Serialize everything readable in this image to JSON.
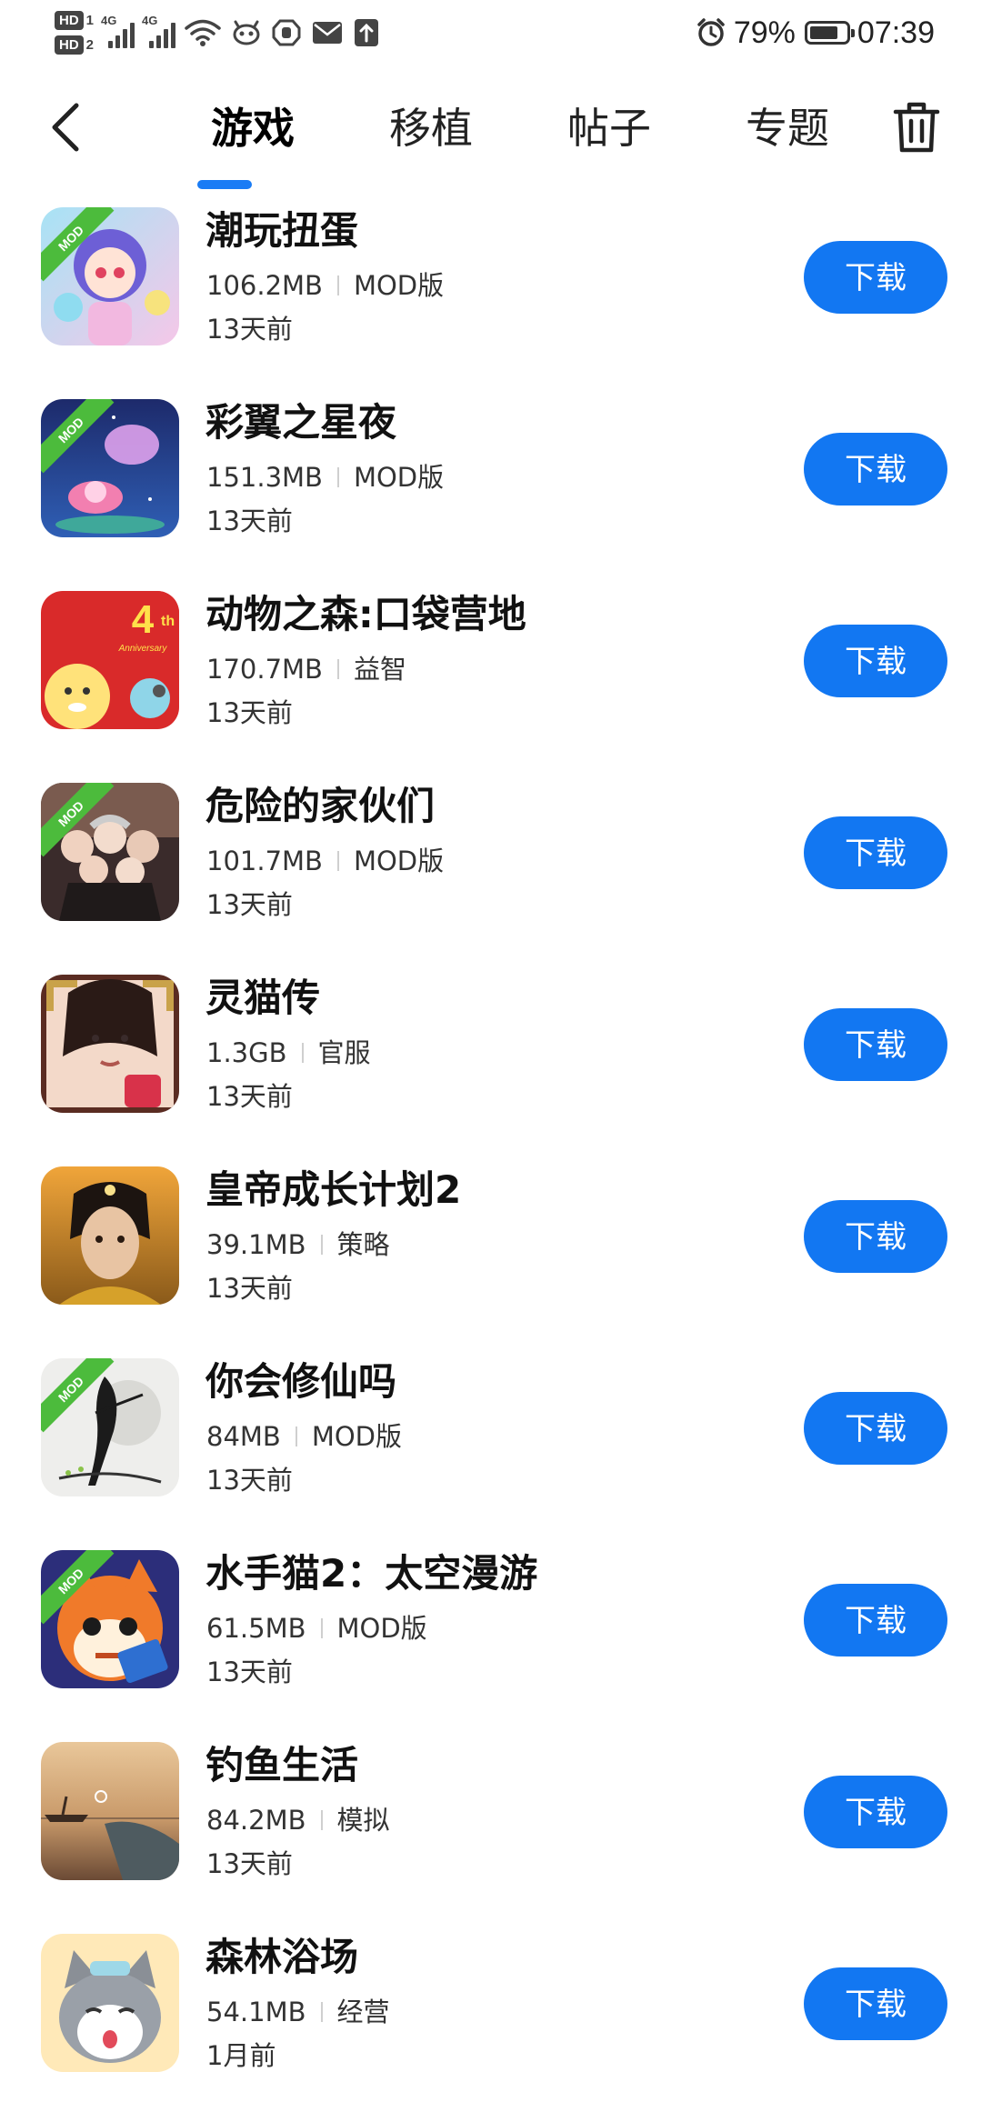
{
  "status_bar": {
    "hd1": "HD",
    "hd1_num": "1",
    "hd2": "HD",
    "hd2_num": "2",
    "network1": "4G",
    "network2": "4G",
    "battery_percent": "79%",
    "battery_level": 0.79,
    "time": "07:39",
    "icons": [
      "signal-icon",
      "signal-icon",
      "wifi-icon",
      "app-notification-icon",
      "hand-icon",
      "mail-icon",
      "upload-icon",
      "alarm-icon",
      "battery-icon"
    ]
  },
  "nav": {
    "back_icon": "chevron-left-icon",
    "tabs": [
      {
        "label": "游戏",
        "active": true
      },
      {
        "label": "移植",
        "active": false
      },
      {
        "label": "帖子",
        "active": false
      },
      {
        "label": "专题",
        "active": false
      }
    ],
    "trash_icon": "trash-icon"
  },
  "accent_color": "#1277f2",
  "mod_ribbon_color": "#4cbb3c",
  "games": [
    {
      "title": "潮玩扭蛋",
      "size": "106.2MB",
      "tag": "MOD版",
      "time": "13天前",
      "button": "下载",
      "mod": true,
      "mod_label": "MOD"
    },
    {
      "title": "彩翼之星夜",
      "size": "151.3MB",
      "tag": "MOD版",
      "time": "13天前",
      "button": "下载",
      "mod": true,
      "mod_label": "MOD"
    },
    {
      "title": "动物之森:口袋营地",
      "size": "170.7MB",
      "tag": "益智",
      "time": "13天前",
      "button": "下载",
      "mod": false,
      "mod_label": ""
    },
    {
      "title": "危险的家伙们",
      "size": "101.7MB",
      "tag": "MOD版",
      "time": "13天前",
      "button": "下载",
      "mod": true,
      "mod_label": "MOD"
    },
    {
      "title": "灵猫传",
      "size": "1.3GB",
      "tag": "官服",
      "time": "13天前",
      "button": "下载",
      "mod": false,
      "mod_label": ""
    },
    {
      "title": "皇帝成长计划2",
      "size": "39.1MB",
      "tag": "策略",
      "time": "13天前",
      "button": "下载",
      "mod": false,
      "mod_label": ""
    },
    {
      "title": "你会修仙吗",
      "size": "84MB",
      "tag": "MOD版",
      "time": "13天前",
      "button": "下载",
      "mod": true,
      "mod_label": "MOD"
    },
    {
      "title": "水手猫2：太空漫游",
      "size": "61.5MB",
      "tag": "MOD版",
      "time": "13天前",
      "button": "下载",
      "mod": true,
      "mod_label": "MOD"
    },
    {
      "title": "钓鱼生活",
      "size": "84.2MB",
      "tag": "模拟",
      "time": "13天前",
      "button": "下载",
      "mod": false,
      "mod_label": ""
    },
    {
      "title": "森林浴场",
      "size": "54.1MB",
      "tag": "经营",
      "time": "1月前",
      "button": "下载",
      "mod": false,
      "mod_label": ""
    }
  ],
  "icon_art": {
    "game_2_badge": "4th",
    "game_2_badge_sub": "Anniversary"
  }
}
